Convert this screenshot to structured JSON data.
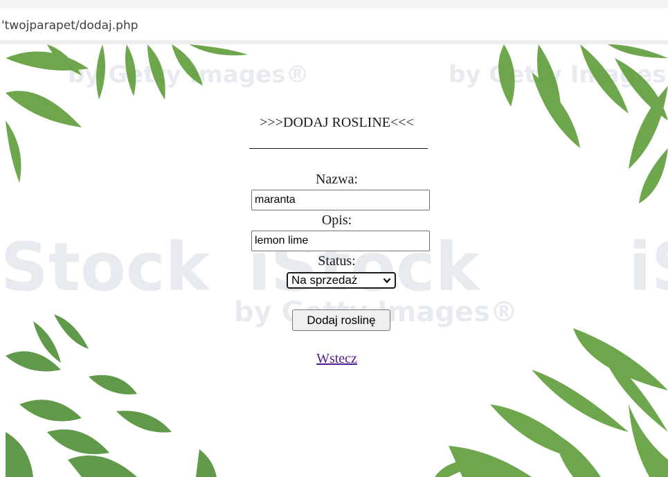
{
  "browser": {
    "url": "'twojparapet/dodaj.php"
  },
  "background": {
    "watermark_brand": "iStock",
    "watermark_tagline": "by Getty Images®",
    "leaf_color": "#5e9d3a"
  },
  "form": {
    "heading": ">>>DODAJ ROSLINE<<<",
    "name_label": "Nazwa:",
    "name_value": "maranta",
    "description_label": "Opis:",
    "description_value": "lemon lime",
    "status_label": "Status:",
    "status_selected": "Na sprzedaż",
    "status_icon": "chevron-down-icon",
    "submit_label": "Dodaj roslinę",
    "back_link": "Wstecz"
  }
}
